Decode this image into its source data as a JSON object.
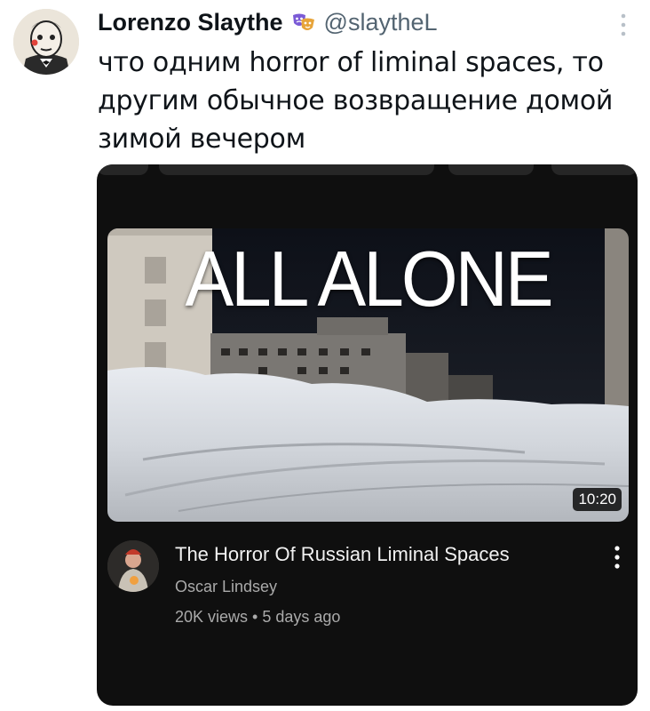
{
  "tweet": {
    "author_name": "Lorenzo Slaythe",
    "handle": "@slaytheL",
    "text_lines": [
      "что одним horror of liminal spaces, то",
      "другим обычное возвращение домой",
      "зимой вечером"
    ]
  },
  "video_card": {
    "thumbnail_text": "ALL ALONE",
    "duration": "10:20",
    "title": "The Horror Of Russian Liminal Spaces",
    "channel": "Oscar Lindsey",
    "views": "20K views",
    "separator": "•",
    "age": "5 days ago"
  },
  "colors": {
    "card_bg": "#0f0f0f",
    "name": "#0f1419",
    "handle": "#536471",
    "video_title": "#f1f1f1",
    "video_meta": "#aaaaaa"
  },
  "icons": {
    "verified_badge": "theater-masks-icon",
    "tweet_menu": "more-dots-icon",
    "video_menu": "kebab-menu-icon"
  }
}
